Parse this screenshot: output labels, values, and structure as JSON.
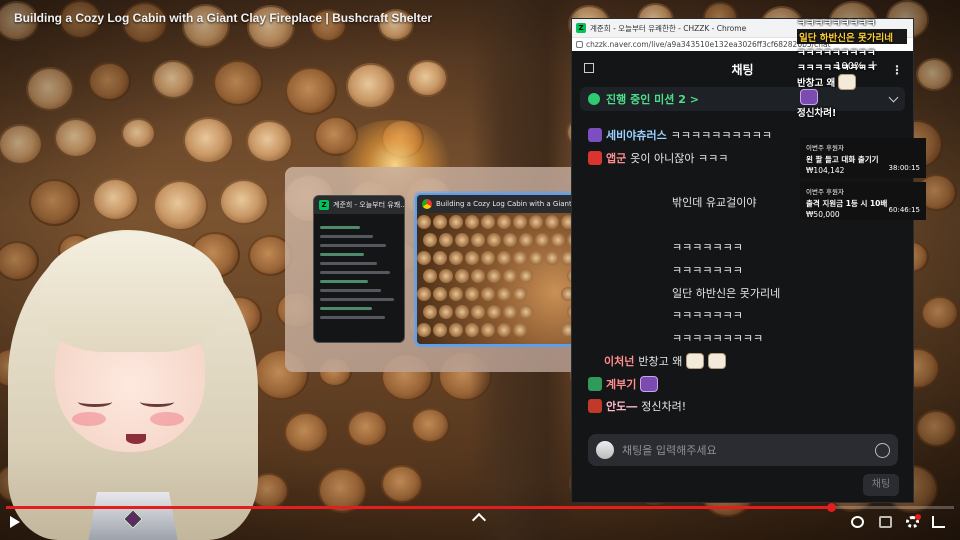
{
  "video": {
    "title": "Building a Cozy Log Cabin with a Giant Clay Fireplace | Bushcraft Shelter",
    "progress_fraction": 0.87
  },
  "switcher": {
    "chat_thumb_title": "계준희 - 오늘부터 유쾌...",
    "video_thumb_title": "Building a Cozy Log Cabin with a Giant Clay Fireplace | Bushcraft Shelter..."
  },
  "chat_window": {
    "tab_title": "계준희 - 오늘부터 유쾌한한 - CHZZK - Chrome",
    "url": "chzzk.naver.com/live/a9a343510e132ea3026ff3cf682820b5/chat",
    "header": "채팅",
    "mission": "진행 중인 미션 2 >",
    "messages": [
      {
        "nick": "세비야츄러스",
        "text": "ㅋㅋㅋㅋㅋㅋㅋㅋㅋㅋ",
        "badge_color": "#7c4fc0",
        "nick_color": "#9bd2ff"
      },
      {
        "nick": "앱군",
        "text": "옷이 아니잖아 ㅋㅋㅋ",
        "badge_color": "#d8352f",
        "nick_color": "#ff8e8e"
      },
      {
        "nick": "",
        "text": "밖인데 유교걸이야",
        "badge_color": "",
        "nick_color": ""
      },
      {
        "nick": "",
        "text": "ㅋㅋㅋㅋㅋㅋㅋ",
        "badge_color": "",
        "nick_color": ""
      },
      {
        "nick": "",
        "text": "ㅋㅋㅋㅋㅋㅋㅋ",
        "badge_color": "",
        "nick_color": ""
      },
      {
        "nick": "",
        "text": "일단 하반신은 못가리네",
        "badge_color": "",
        "nick_color": ""
      },
      {
        "nick": "",
        "text": "ㅋㅋㅋㅋㅋㅋㅋ",
        "badge_color": "",
        "nick_color": ""
      },
      {
        "nick": "",
        "text": "ㅋㅋㅋㅋㅋㅋㅋㅋㅋ",
        "badge_color": "",
        "nick_color": ""
      },
      {
        "nick": "이처넌",
        "text": "반창고 왜",
        "badge_color": "",
        "nick_color": "#ff8e8e"
      },
      {
        "nick": "계부기",
        "text": "",
        "badge_color": "#2f9b5a",
        "nick_color": "#ff8e8e"
      },
      {
        "nick": "안도―",
        "text": "정신차려!",
        "badge_color": "#c0392b",
        "nick_color": "#ffb7c9"
      }
    ],
    "input_placeholder": "채팅을 입력해주세요",
    "send_label": "채팅"
  },
  "floating": {
    "lines": [
      {
        "text": "ㅋㅋㅋㅋㅋㅋㅋㅋㅋ",
        "highlight": false
      },
      {
        "text": "일단 하반신은 못가리네",
        "highlight": true
      },
      {
        "text": "ㅋㅋㅋㅋㅋㅋㅋㅋㅋ",
        "highlight": false
      },
      {
        "text": "ㅋㅋㅋㅋㅋㅋㅋㅋㅋ",
        "highlight": false
      },
      {
        "text": "반창고 왜",
        "highlight": false
      },
      {
        "text": "",
        "highlight": false
      },
      {
        "text": "정신차려!",
        "highlight": false
      }
    ],
    "zoom": "100%",
    "zoom_plus": "+"
  },
  "donations": [
    {
      "top": "이번주 후원자",
      "title": "왼 팔 들고 대화 출기기",
      "amount": "₩104,142",
      "time": "38:00:15"
    },
    {
      "top": "이번주 후원자",
      "title": "출격 지원금 1등 시 10배",
      "amount": "₩50,000",
      "time": "60:46:15"
    }
  ],
  "colors": {
    "accent_green": "#00c35a",
    "progress_red": "#e21e1e",
    "chat_bg": "#141517"
  }
}
